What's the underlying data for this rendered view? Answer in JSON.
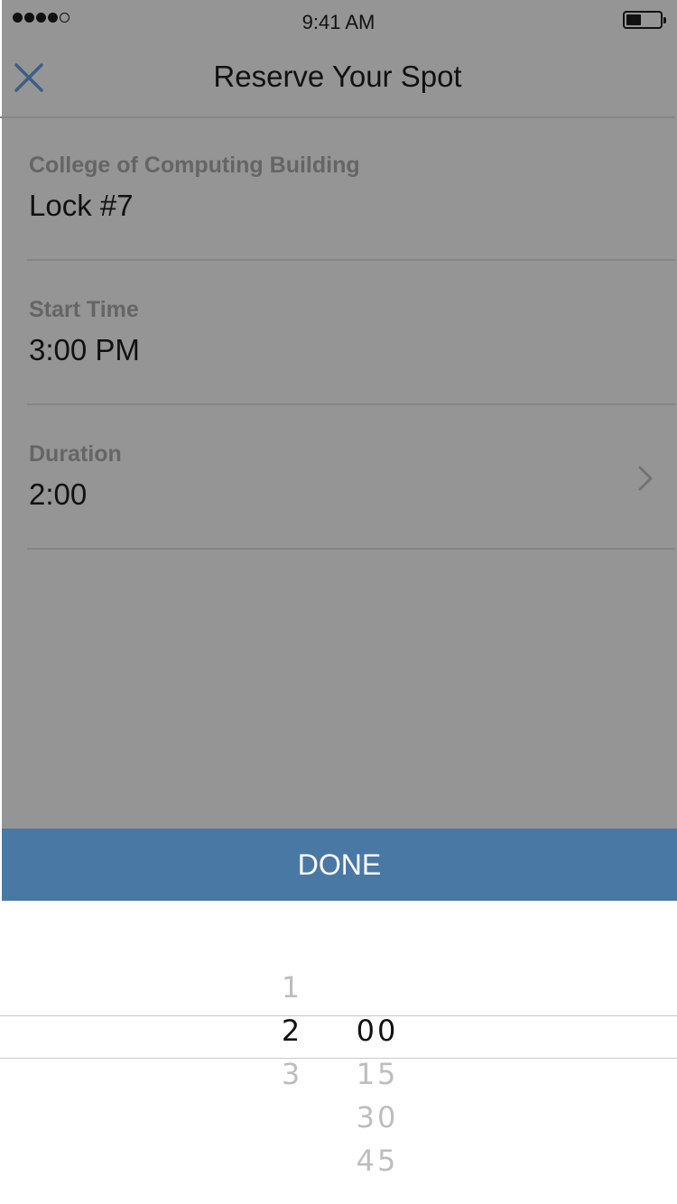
{
  "status_bar": {
    "time": "9:41 AM",
    "signal_filled": 4,
    "signal_total": 5
  },
  "nav": {
    "title": "Reserve Your Spot",
    "close_icon": "close-icon"
  },
  "rows": [
    {
      "label": "College of Computing Building",
      "value": "Lock #7"
    },
    {
      "label": "Start Time",
      "value": "3:00 PM"
    },
    {
      "label": "Duration",
      "value": "2:00",
      "has_chevron": true
    }
  ],
  "done_label": "DONE",
  "picker": {
    "hours": [
      "1",
      "2",
      "3"
    ],
    "minutes": [
      "00",
      "15",
      "30",
      "45"
    ],
    "selected_hour": "2",
    "selected_minute": "00"
  },
  "colors": {
    "overlay": "#959595",
    "accent": "#4a78a5",
    "close_icon": "#3b5f86"
  }
}
